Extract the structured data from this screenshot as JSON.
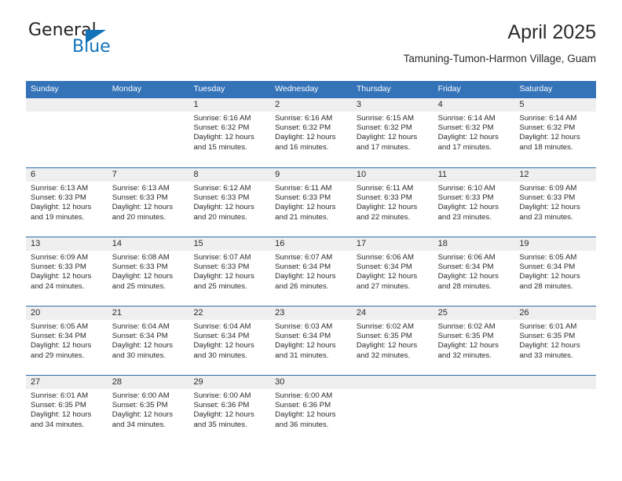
{
  "logo": {
    "word_general": "General",
    "word_blue": "Blue",
    "triangle_icon": "triangle-icon",
    "accent_color": "#1272b8"
  },
  "header": {
    "title": "April 2025",
    "subtitle": "Tamuning-Tumon-Harmon Village, Guam"
  },
  "theme": {
    "header_blue": "#3573b9",
    "row_border_blue": "#2e6daa",
    "daynum_band": "#efefef",
    "text": "#2b2b2b"
  },
  "weekday_headers": [
    "Sunday",
    "Monday",
    "Tuesday",
    "Wednesday",
    "Thursday",
    "Friday",
    "Saturday"
  ],
  "weeks": [
    [
      {
        "day": "",
        "sunrise": "",
        "sunset": "",
        "daylight1": "",
        "daylight2": ""
      },
      {
        "day": "",
        "sunrise": "",
        "sunset": "",
        "daylight1": "",
        "daylight2": ""
      },
      {
        "day": "1",
        "sunrise": "Sunrise: 6:16 AM",
        "sunset": "Sunset: 6:32 PM",
        "daylight1": "Daylight: 12 hours",
        "daylight2": "and 15 minutes."
      },
      {
        "day": "2",
        "sunrise": "Sunrise: 6:16 AM",
        "sunset": "Sunset: 6:32 PM",
        "daylight1": "Daylight: 12 hours",
        "daylight2": "and 16 minutes."
      },
      {
        "day": "3",
        "sunrise": "Sunrise: 6:15 AM",
        "sunset": "Sunset: 6:32 PM",
        "daylight1": "Daylight: 12 hours",
        "daylight2": "and 17 minutes."
      },
      {
        "day": "4",
        "sunrise": "Sunrise: 6:14 AM",
        "sunset": "Sunset: 6:32 PM",
        "daylight1": "Daylight: 12 hours",
        "daylight2": "and 17 minutes."
      },
      {
        "day": "5",
        "sunrise": "Sunrise: 6:14 AM",
        "sunset": "Sunset: 6:32 PM",
        "daylight1": "Daylight: 12 hours",
        "daylight2": "and 18 minutes."
      }
    ],
    [
      {
        "day": "6",
        "sunrise": "Sunrise: 6:13 AM",
        "sunset": "Sunset: 6:33 PM",
        "daylight1": "Daylight: 12 hours",
        "daylight2": "and 19 minutes."
      },
      {
        "day": "7",
        "sunrise": "Sunrise: 6:13 AM",
        "sunset": "Sunset: 6:33 PM",
        "daylight1": "Daylight: 12 hours",
        "daylight2": "and 20 minutes."
      },
      {
        "day": "8",
        "sunrise": "Sunrise: 6:12 AM",
        "sunset": "Sunset: 6:33 PM",
        "daylight1": "Daylight: 12 hours",
        "daylight2": "and 20 minutes."
      },
      {
        "day": "9",
        "sunrise": "Sunrise: 6:11 AM",
        "sunset": "Sunset: 6:33 PM",
        "daylight1": "Daylight: 12 hours",
        "daylight2": "and 21 minutes."
      },
      {
        "day": "10",
        "sunrise": "Sunrise: 6:11 AM",
        "sunset": "Sunset: 6:33 PM",
        "daylight1": "Daylight: 12 hours",
        "daylight2": "and 22 minutes."
      },
      {
        "day": "11",
        "sunrise": "Sunrise: 6:10 AM",
        "sunset": "Sunset: 6:33 PM",
        "daylight1": "Daylight: 12 hours",
        "daylight2": "and 23 minutes."
      },
      {
        "day": "12",
        "sunrise": "Sunrise: 6:09 AM",
        "sunset": "Sunset: 6:33 PM",
        "daylight1": "Daylight: 12 hours",
        "daylight2": "and 23 minutes."
      }
    ],
    [
      {
        "day": "13",
        "sunrise": "Sunrise: 6:09 AM",
        "sunset": "Sunset: 6:33 PM",
        "daylight1": "Daylight: 12 hours",
        "daylight2": "and 24 minutes."
      },
      {
        "day": "14",
        "sunrise": "Sunrise: 6:08 AM",
        "sunset": "Sunset: 6:33 PM",
        "daylight1": "Daylight: 12 hours",
        "daylight2": "and 25 minutes."
      },
      {
        "day": "15",
        "sunrise": "Sunrise: 6:07 AM",
        "sunset": "Sunset: 6:33 PM",
        "daylight1": "Daylight: 12 hours",
        "daylight2": "and 25 minutes."
      },
      {
        "day": "16",
        "sunrise": "Sunrise: 6:07 AM",
        "sunset": "Sunset: 6:34 PM",
        "daylight1": "Daylight: 12 hours",
        "daylight2": "and 26 minutes."
      },
      {
        "day": "17",
        "sunrise": "Sunrise: 6:06 AM",
        "sunset": "Sunset: 6:34 PM",
        "daylight1": "Daylight: 12 hours",
        "daylight2": "and 27 minutes."
      },
      {
        "day": "18",
        "sunrise": "Sunrise: 6:06 AM",
        "sunset": "Sunset: 6:34 PM",
        "daylight1": "Daylight: 12 hours",
        "daylight2": "and 28 minutes."
      },
      {
        "day": "19",
        "sunrise": "Sunrise: 6:05 AM",
        "sunset": "Sunset: 6:34 PM",
        "daylight1": "Daylight: 12 hours",
        "daylight2": "and 28 minutes."
      }
    ],
    [
      {
        "day": "20",
        "sunrise": "Sunrise: 6:05 AM",
        "sunset": "Sunset: 6:34 PM",
        "daylight1": "Daylight: 12 hours",
        "daylight2": "and 29 minutes."
      },
      {
        "day": "21",
        "sunrise": "Sunrise: 6:04 AM",
        "sunset": "Sunset: 6:34 PM",
        "daylight1": "Daylight: 12 hours",
        "daylight2": "and 30 minutes."
      },
      {
        "day": "22",
        "sunrise": "Sunrise: 6:04 AM",
        "sunset": "Sunset: 6:34 PM",
        "daylight1": "Daylight: 12 hours",
        "daylight2": "and 30 minutes."
      },
      {
        "day": "23",
        "sunrise": "Sunrise: 6:03 AM",
        "sunset": "Sunset: 6:34 PM",
        "daylight1": "Daylight: 12 hours",
        "daylight2": "and 31 minutes."
      },
      {
        "day": "24",
        "sunrise": "Sunrise: 6:02 AM",
        "sunset": "Sunset: 6:35 PM",
        "daylight1": "Daylight: 12 hours",
        "daylight2": "and 32 minutes."
      },
      {
        "day": "25",
        "sunrise": "Sunrise: 6:02 AM",
        "sunset": "Sunset: 6:35 PM",
        "daylight1": "Daylight: 12 hours",
        "daylight2": "and 32 minutes."
      },
      {
        "day": "26",
        "sunrise": "Sunrise: 6:01 AM",
        "sunset": "Sunset: 6:35 PM",
        "daylight1": "Daylight: 12 hours",
        "daylight2": "and 33 minutes."
      }
    ],
    [
      {
        "day": "27",
        "sunrise": "Sunrise: 6:01 AM",
        "sunset": "Sunset: 6:35 PM",
        "daylight1": "Daylight: 12 hours",
        "daylight2": "and 34 minutes."
      },
      {
        "day": "28",
        "sunrise": "Sunrise: 6:00 AM",
        "sunset": "Sunset: 6:35 PM",
        "daylight1": "Daylight: 12 hours",
        "daylight2": "and 34 minutes."
      },
      {
        "day": "29",
        "sunrise": "Sunrise: 6:00 AM",
        "sunset": "Sunset: 6:36 PM",
        "daylight1": "Daylight: 12 hours",
        "daylight2": "and 35 minutes."
      },
      {
        "day": "30",
        "sunrise": "Sunrise: 6:00 AM",
        "sunset": "Sunset: 6:36 PM",
        "daylight1": "Daylight: 12 hours",
        "daylight2": "and 36 minutes."
      },
      {
        "day": "",
        "sunrise": "",
        "sunset": "",
        "daylight1": "",
        "daylight2": ""
      },
      {
        "day": "",
        "sunrise": "",
        "sunset": "",
        "daylight1": "",
        "daylight2": ""
      },
      {
        "day": "",
        "sunrise": "",
        "sunset": "",
        "daylight1": "",
        "daylight2": ""
      }
    ]
  ]
}
